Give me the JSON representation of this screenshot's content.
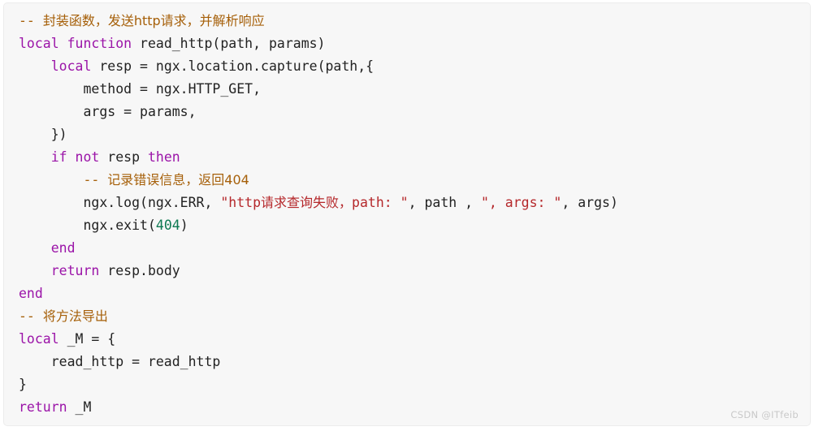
{
  "editor": {
    "language": "lua",
    "background_color": "#f7f7f7",
    "border_color": "#ececec",
    "theme": {
      "keyword_color": "#9b14a8",
      "comment_color": "#a6600a",
      "string_color": "#b5282b",
      "number_color": "#0e7a52",
      "text_color": "#222222"
    },
    "lines": [
      {
        "index": 1,
        "indent": 0,
        "text": "-- 封装函数，发送http请求，并解析响应",
        "tokens": [
          {
            "t": "-- ",
            "k": "cmt"
          },
          {
            "t": "封装函数，发送http请求，并解析响应",
            "k": "cmt",
            "cjk": true
          }
        ]
      },
      {
        "index": 2,
        "indent": 0,
        "text": "local function read_http(path, params)",
        "tokens": [
          {
            "t": "local function",
            "k": "kw"
          },
          {
            "t": " read_http(path, params)",
            "k": "plain"
          }
        ]
      },
      {
        "index": 3,
        "indent": 1,
        "text": "    local resp = ngx.location.capture(path,{",
        "tokens": [
          {
            "t": "    ",
            "k": "plain"
          },
          {
            "t": "local",
            "k": "kw"
          },
          {
            "t": " resp = ngx.location.capture(path,{",
            "k": "plain"
          }
        ]
      },
      {
        "index": 4,
        "indent": 2,
        "text": "        method = ngx.HTTP_GET,",
        "tokens": [
          {
            "t": "        method = ngx.HTTP_GET,",
            "k": "plain"
          }
        ]
      },
      {
        "index": 5,
        "indent": 2,
        "text": "        args = params,",
        "tokens": [
          {
            "t": "        args = params,",
            "k": "plain"
          }
        ]
      },
      {
        "index": 6,
        "indent": 1,
        "text": "    })",
        "tokens": [
          {
            "t": "    })",
            "k": "plain"
          }
        ]
      },
      {
        "index": 7,
        "indent": 1,
        "text": "    if not resp then",
        "tokens": [
          {
            "t": "    ",
            "k": "plain"
          },
          {
            "t": "if not",
            "k": "kw"
          },
          {
            "t": " resp ",
            "k": "plain"
          },
          {
            "t": "then",
            "k": "kw"
          }
        ]
      },
      {
        "index": 8,
        "indent": 2,
        "text": "        -- 记录错误信息，返回404",
        "tokens": [
          {
            "t": "        ",
            "k": "plain"
          },
          {
            "t": "-- ",
            "k": "cmt"
          },
          {
            "t": "记录错误信息，返回404",
            "k": "cmt",
            "cjk": true
          }
        ]
      },
      {
        "index": 9,
        "indent": 2,
        "text": "        ngx.log(ngx.ERR, \"http请求查询失败，path: \", path , \", args: \", args)",
        "tokens": [
          {
            "t": "        ngx.log(ngx.ERR, ",
            "k": "plain"
          },
          {
            "t": "\"http",
            "k": "str"
          },
          {
            "t": "请求查询失败，",
            "k": "str",
            "cjk": true
          },
          {
            "t": "path: \"",
            "k": "str"
          },
          {
            "t": ", path , ",
            "k": "plain"
          },
          {
            "t": "\", args: \"",
            "k": "str"
          },
          {
            "t": ", args)",
            "k": "plain"
          }
        ]
      },
      {
        "index": 10,
        "indent": 2,
        "text": "        ngx.exit(404)",
        "tokens": [
          {
            "t": "        ngx.exit(",
            "k": "plain"
          },
          {
            "t": "404",
            "k": "num"
          },
          {
            "t": ")",
            "k": "plain"
          }
        ]
      },
      {
        "index": 11,
        "indent": 1,
        "text": "    end",
        "tokens": [
          {
            "t": "    ",
            "k": "plain"
          },
          {
            "t": "end",
            "k": "kw"
          }
        ]
      },
      {
        "index": 12,
        "indent": 1,
        "text": "    return resp.body",
        "tokens": [
          {
            "t": "    ",
            "k": "plain"
          },
          {
            "t": "return",
            "k": "kw"
          },
          {
            "t": " resp.body",
            "k": "plain"
          }
        ]
      },
      {
        "index": 13,
        "indent": 0,
        "text": "end",
        "tokens": [
          {
            "t": "end",
            "k": "kw"
          }
        ]
      },
      {
        "index": 14,
        "indent": 0,
        "text": "-- 将方法导出",
        "tokens": [
          {
            "t": "-- ",
            "k": "cmt"
          },
          {
            "t": "将方法导出",
            "k": "cmt",
            "cjk": true
          }
        ]
      },
      {
        "index": 15,
        "indent": 0,
        "text": "local _M = {",
        "tokens": [
          {
            "t": "local",
            "k": "kw"
          },
          {
            "t": " _M = {",
            "k": "plain"
          }
        ]
      },
      {
        "index": 16,
        "indent": 1,
        "text": "    read_http = read_http",
        "tokens": [
          {
            "t": "    read_http = read_http",
            "k": "plain"
          }
        ]
      },
      {
        "index": 17,
        "indent": 0,
        "text": "}",
        "tokens": [
          {
            "t": "}",
            "k": "plain"
          }
        ]
      },
      {
        "index": 18,
        "indent": 0,
        "text": "return _M",
        "tokens": [
          {
            "t": "return",
            "k": "kw"
          },
          {
            "t": " _M",
            "k": "plain"
          }
        ]
      }
    ]
  },
  "watermark": {
    "label": "CSDN @ITfeib"
  }
}
